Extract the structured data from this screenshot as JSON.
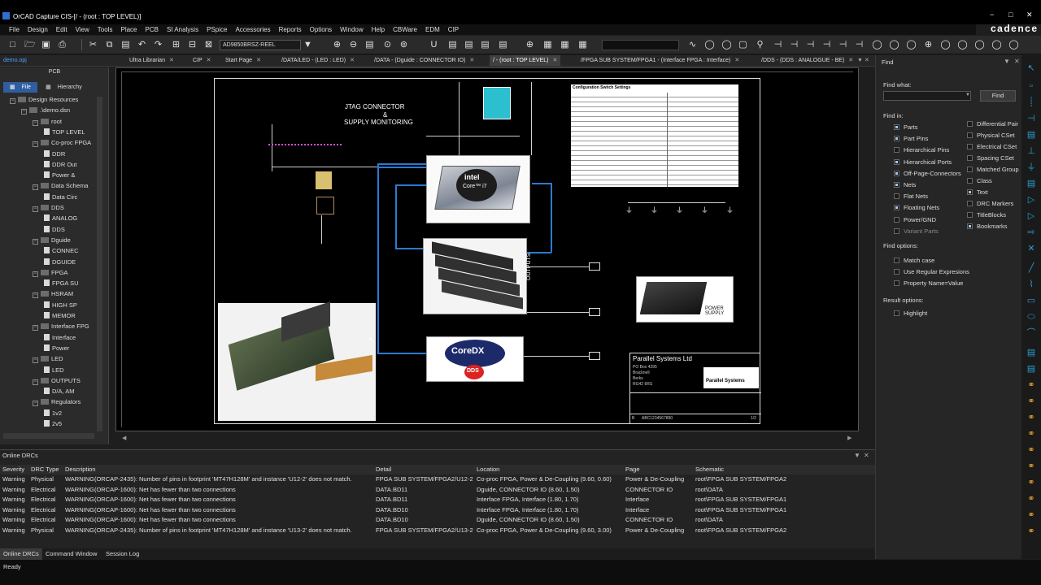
{
  "window": {
    "title": "OrCAD Capture CIS-[/ - (root : TOP LEVEL)]",
    "brand": "cadence",
    "min": "−",
    "max": "□",
    "close": "✕"
  },
  "menu": [
    "File",
    "Design",
    "Edit",
    "View",
    "Tools",
    "Place",
    "PCB",
    "SI Analysis",
    "PSpice",
    "Accessories",
    "Reports",
    "Options",
    "Window",
    "Help",
    "CBWare",
    "EDM",
    "CIP"
  ],
  "toolbar": {
    "part_combo": "AD9850BRSZ-REEL"
  },
  "tabs": [
    {
      "label": "demo.opj"
    },
    {
      "label": "Ultra Librarian"
    },
    {
      "label": "CIP"
    },
    {
      "label": "Start Page"
    },
    {
      "label": "/DATA/LED - (LED : LED)"
    },
    {
      "label": "/DATA - (Dguide : CONNECTOR IO)"
    },
    {
      "label": "/ - (root : TOP LEVEL)"
    },
    {
      "label": "/FPGA SUB SYSTEM/FPGA1 - (Interface FPGA : Interface)"
    },
    {
      "label": "/DDS - (DDS : ANALOGUE - BE)"
    }
  ],
  "left_panel": {
    "title": "PCB",
    "tab_file": "File",
    "tab_hierarchy": "Hierarchy",
    "tree": [
      {
        "label": "Design Resources",
        "lvl": 0,
        "kind": "folder",
        "box": "−"
      },
      {
        "label": ".\\demo.dsn",
        "lvl": 1,
        "kind": "dsn",
        "box": "−"
      },
      {
        "label": "root",
        "lvl": 2,
        "kind": "folder",
        "box": "−"
      },
      {
        "label": "TOP LEVEL",
        "lvl": 3,
        "kind": "page",
        "box": ""
      },
      {
        "label": "Co-proc FPGA",
        "lvl": 2,
        "kind": "folder",
        "box": "−"
      },
      {
        "label": "DDR",
        "lvl": 3,
        "kind": "page",
        "box": ""
      },
      {
        "label": "DDR Out",
        "lvl": 3,
        "kind": "page",
        "box": ""
      },
      {
        "label": "Power &",
        "lvl": 3,
        "kind": "page",
        "box": ""
      },
      {
        "label": "Data Schema",
        "lvl": 2,
        "kind": "folder",
        "box": "−"
      },
      {
        "label": "Data Circ",
        "lvl": 3,
        "kind": "page",
        "box": ""
      },
      {
        "label": "DDS",
        "lvl": 2,
        "kind": "folder",
        "box": "−"
      },
      {
        "label": "ANALOG",
        "lvl": 3,
        "kind": "page",
        "box": ""
      },
      {
        "label": "DDS",
        "lvl": 3,
        "kind": "page",
        "box": ""
      },
      {
        "label": "Dguide",
        "lvl": 2,
        "kind": "folder",
        "box": "−"
      },
      {
        "label": "CONNEC",
        "lvl": 3,
        "kind": "page",
        "box": ""
      },
      {
        "label": "DGUIDE",
        "lvl": 3,
        "kind": "page",
        "box": ""
      },
      {
        "label": "FPGA",
        "lvl": 2,
        "kind": "folder",
        "box": "−"
      },
      {
        "label": "FPGA SU",
        "lvl": 3,
        "kind": "page",
        "box": ""
      },
      {
        "label": "HSRAM",
        "lvl": 2,
        "kind": "folder",
        "box": "−"
      },
      {
        "label": "HIGH SP",
        "lvl": 3,
        "kind": "page",
        "box": ""
      },
      {
        "label": "MEMOR",
        "lvl": 3,
        "kind": "page",
        "box": ""
      },
      {
        "label": "Interface FPG",
        "lvl": 2,
        "kind": "folder",
        "box": "−"
      },
      {
        "label": "Interface",
        "lvl": 3,
        "kind": "page",
        "box": ""
      },
      {
        "label": "Power",
        "lvl": 3,
        "kind": "page",
        "box": ""
      },
      {
        "label": "LED",
        "lvl": 2,
        "kind": "folder",
        "box": "−"
      },
      {
        "label": "LED",
        "lvl": 3,
        "kind": "page",
        "box": ""
      },
      {
        "label": "OUTPUTS",
        "lvl": 2,
        "kind": "folder",
        "box": "−"
      },
      {
        "label": "D/A, AM",
        "lvl": 3,
        "kind": "page",
        "box": ""
      },
      {
        "label": "Regulators",
        "lvl": 2,
        "kind": "folder",
        "box": "−"
      },
      {
        "label": "1v2",
        "lvl": 3,
        "kind": "page",
        "box": ""
      },
      {
        "label": "2v5",
        "lvl": 3,
        "kind": "page",
        "box": ""
      }
    ]
  },
  "schematic": {
    "jtag_line1": "JTAG CONNECTOR",
    "jtag_line2": "&",
    "jtag_line3": "SUPPLY MONITORING",
    "cpu_brand": "intel",
    "cpu_model": "Core™ i7",
    "coredx": "CoreDX",
    "dds": "DDS",
    "outputs": "OUTPUTS",
    "power_supply": "POWER SUPPLY",
    "config_title": "Configuration Switch Settings",
    "config_col_switch": "Switch",
    "config_col_function": "Function",
    "title_company": "Parallel Systems Ltd",
    "title_addr": [
      "PO Box 4295",
      "Bracknell",
      "Berks",
      "RG42 6RS"
    ],
    "title_logo": "Parallel Systems",
    "title_doc": "ABC1234567890",
    "title_sheet": "1/2",
    "title_rev": "B"
  },
  "find_panel": {
    "title": "Find",
    "find_what": "Find what:",
    "find_button": "Find",
    "find_in": "Find in:",
    "col1": [
      {
        "label": "Parts",
        "on": true
      },
      {
        "label": "Part Pins",
        "on": true
      },
      {
        "label": "Hierarchical Pins",
        "on": false
      },
      {
        "label": "Hierarchical Ports",
        "on": true
      },
      {
        "label": "Off-Page-Connectors",
        "on": true
      },
      {
        "label": "Nets",
        "on": true
      },
      {
        "label": "Flat Nets",
        "on": false
      },
      {
        "label": "Floating Nets",
        "on": true
      },
      {
        "label": "Power/GND",
        "on": false
      },
      {
        "label": "Variant Parts",
        "on": false
      }
    ],
    "col2": [
      {
        "label": "Differential Pair",
        "on": false
      },
      {
        "label": "Physical CSet",
        "on": false
      },
      {
        "label": "Electrical CSet",
        "on": false
      },
      {
        "label": "Spacing CSet",
        "on": false
      },
      {
        "label": "Matched Group",
        "on": false
      },
      {
        "label": "Class",
        "on": false
      },
      {
        "label": "Text",
        "on": true
      },
      {
        "label": "DRC Markers",
        "on": false
      },
      {
        "label": "TitleBlocks",
        "on": false
      },
      {
        "label": "Bookmarks",
        "on": true
      }
    ],
    "find_options": "Find options:",
    "options": [
      {
        "label": "Match case",
        "on": false
      },
      {
        "label": "Use Regular Expresions",
        "on": false
      },
      {
        "label": "Property Name=Value",
        "on": false
      }
    ],
    "result_options": "Result options:",
    "highlight": "Highlight"
  },
  "drc": {
    "title": "Online DRCs",
    "headers": [
      "Severity",
      "DRC Type",
      "Description",
      "Detail",
      "Location",
      "Page",
      "Schematic"
    ],
    "rows": [
      [
        "Warning",
        "Physical",
        "WARNING(ORCAP-2435): Number of pins in footprint 'MT47H128M' and instance 'U12-2' does not match.",
        "FPGA SUB SYSTEM/FPGA2/U12-2",
        "Co-proc FPGA, Power & De-Coupling  (9.60, 0.60)",
        "Power & De-Coupling",
        "root\\FPGA SUB SYSTEM/FPGA2"
      ],
      [
        "Warning",
        "Electrical",
        "WARNING(ORCAP-1600): Net has fewer than two connections",
        "DATA.BD11",
        "Dguide, CONNECTOR IO  (8.60, 1.50)",
        "CONNECTOR IO",
        "root\\DATA"
      ],
      [
        "Warning",
        "Electrical",
        "WARNING(ORCAP-1600): Net has fewer than two connections",
        "DATA.BD11",
        "Interface FPGA, Interface  (1.80, 1.70)",
        "Interface",
        "root\\FPGA SUB SYSTEM/FPGA1"
      ],
      [
        "Warning",
        "Electrical",
        "WARNING(ORCAP-1600): Net has fewer than two connections",
        "DATA.BD10",
        "Interface FPGA, Interface  (1.80, 1.70)",
        "Interface",
        "root\\FPGA SUB SYSTEM/FPGA1"
      ],
      [
        "Warning",
        "Electrical",
        "WARNING(ORCAP-1600): Net has fewer than two connections",
        "DATA.BD10",
        "Dguide, CONNECTOR IO  (8.60, 1.50)",
        "CONNECTOR IO",
        "root\\DATA"
      ],
      [
        "Warning",
        "Physical",
        "WARNING(ORCAP-2435): Number of pins in footprint 'MT47H128M' and instance 'U13-2' does not match.",
        "FPGA SUB SYSTEM/FPGA2/U13-2",
        "Co-proc FPGA, Power & De-Coupling  (9.60, 3.00)",
        "Power & De-Coupling",
        "root\\FPGA SUB SYSTEM/FPGA2"
      ]
    ]
  },
  "bottom_tabs": [
    "Online DRCs",
    "Command Window",
    "Session Log"
  ],
  "status": "Ready"
}
